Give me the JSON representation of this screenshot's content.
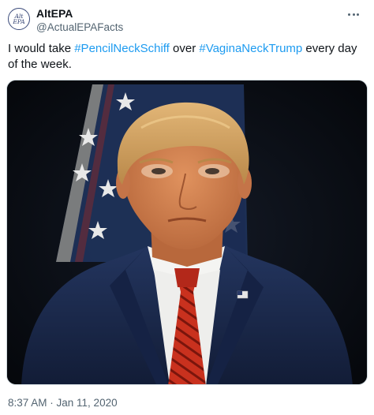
{
  "author": {
    "display_name": "AltEPA",
    "handle": "@ActualEPAFacts",
    "avatar_text_line1": "Alt",
    "avatar_text_line2": "EPA"
  },
  "menu_icon": "more-horizontal-icon",
  "tweet": {
    "text_before": "I would take ",
    "hashtag_1": "#PencilNeckSchiff",
    "text_middle": " over ",
    "hashtag_2": "#VaginaNeckTrump",
    "text_after": " every day of the week."
  },
  "media": {
    "description_icon": "photo",
    "colors": {
      "background": "#0a0d14",
      "flag_blue": "#1f3159",
      "flag_stripe": "#9b9486",
      "suit": "#1b2a4c",
      "shirt": "#f4f4f2",
      "tie": "#c9311e",
      "tie_stripe": "#7a150c",
      "skin": "#d08050",
      "hair": "#d3a05f"
    }
  },
  "timestamp": "8:37 AM · Jan 11, 2020",
  "accent_color": "#1d9bf0"
}
